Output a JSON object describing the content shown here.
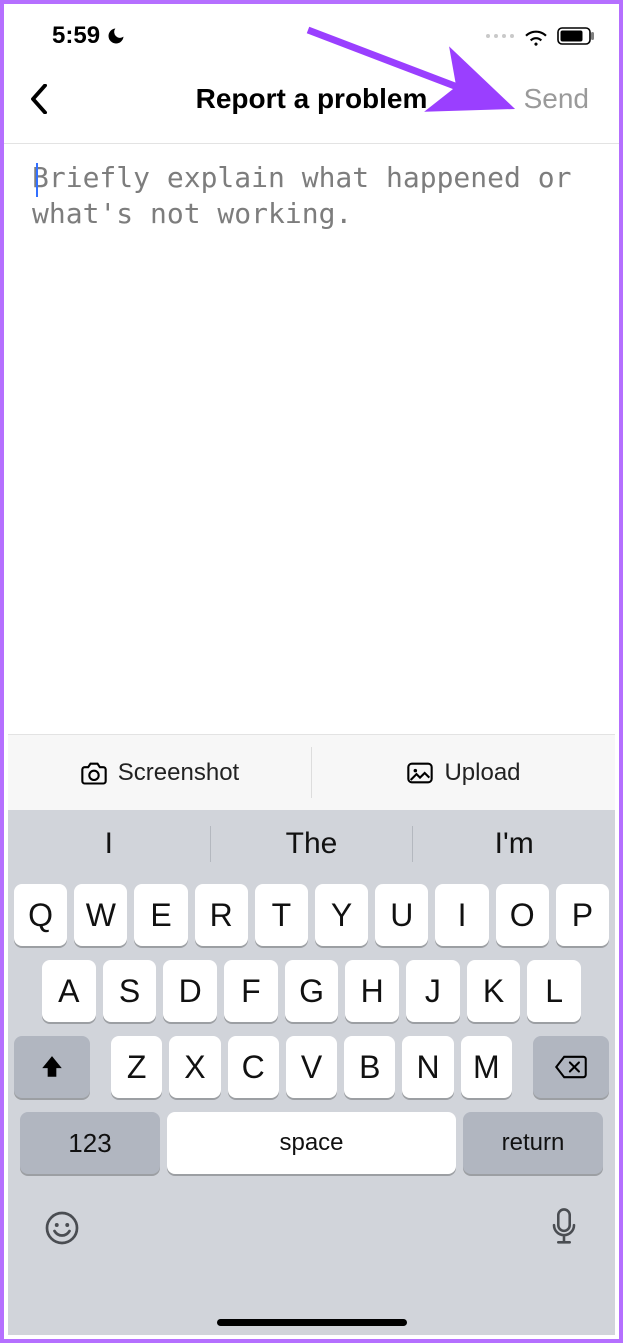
{
  "status": {
    "time": "5:59"
  },
  "header": {
    "title": "Report a problem",
    "send": "Send"
  },
  "input": {
    "placeholder": "Briefly explain what happened or what's not working."
  },
  "attach": {
    "screenshot": "Screenshot",
    "upload": "Upload"
  },
  "suggest": [
    "I",
    "The",
    "I'm"
  ],
  "keys": {
    "row1": [
      "Q",
      "W",
      "E",
      "R",
      "T",
      "Y",
      "U",
      "I",
      "O",
      "P"
    ],
    "row2": [
      "A",
      "S",
      "D",
      "F",
      "G",
      "H",
      "J",
      "K",
      "L"
    ],
    "row3": [
      "Z",
      "X",
      "C",
      "V",
      "B",
      "N",
      "M"
    ],
    "numkey": "123",
    "space": "space",
    "returnkey": "return"
  }
}
